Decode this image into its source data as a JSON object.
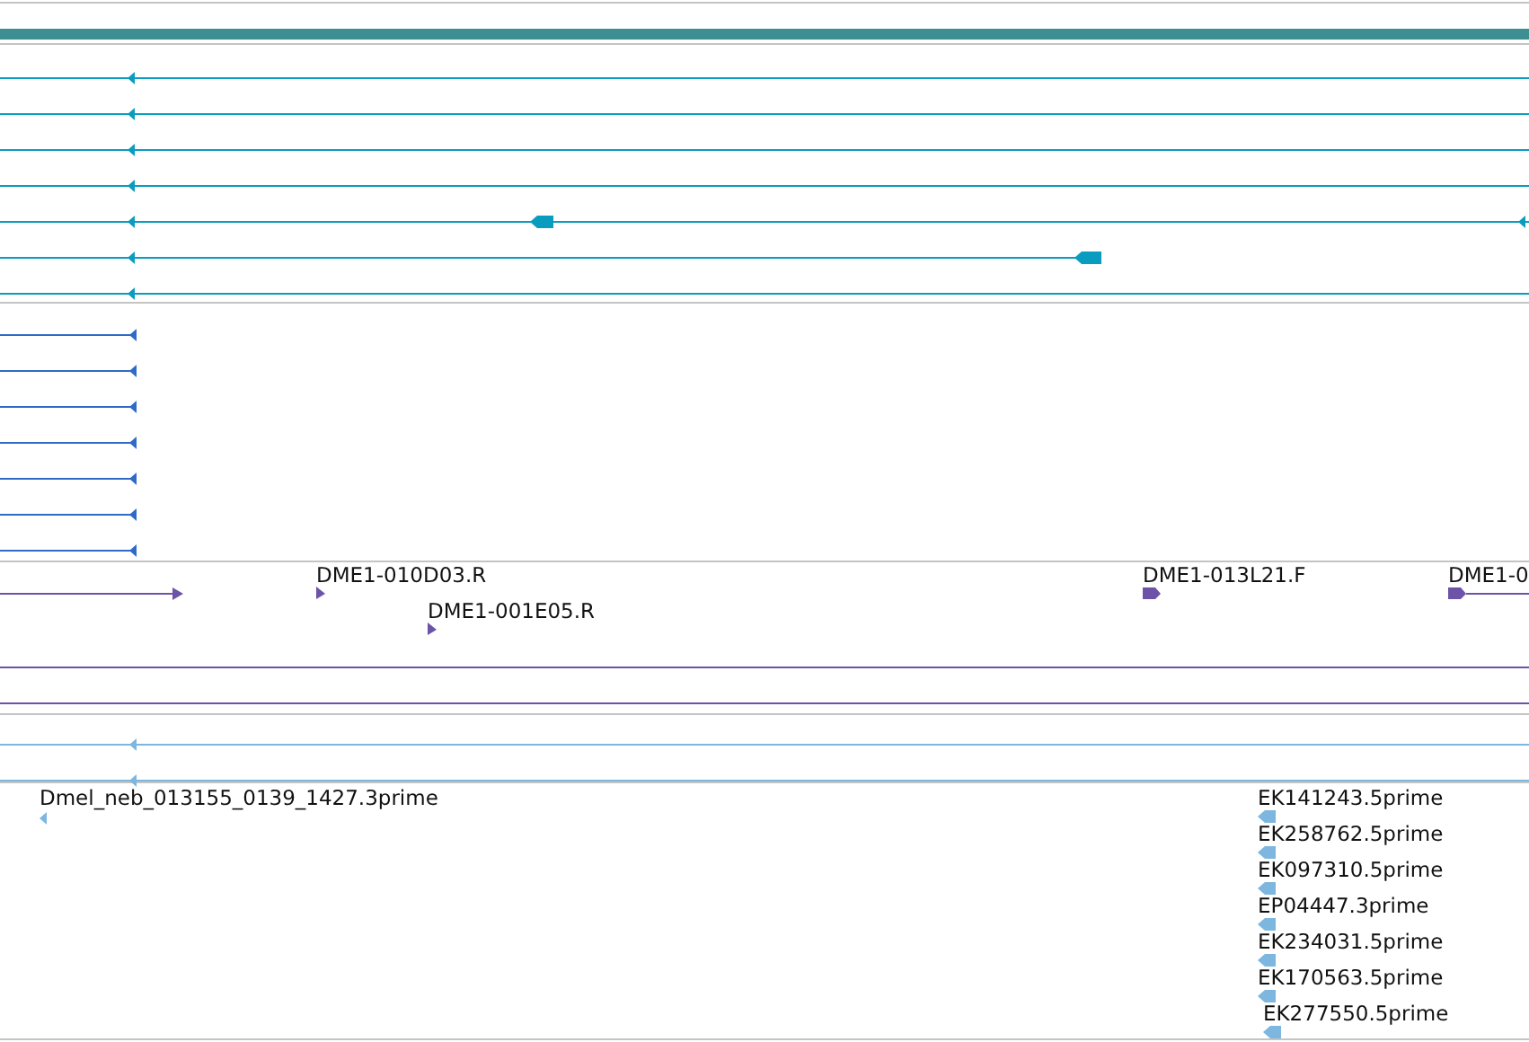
{
  "header_bar": {
    "color": "#3d8f93"
  },
  "tracks": [
    {
      "color": "#0a9cbf"
    },
    {
      "color": "#2f6bc6"
    },
    {
      "color": "#6d53a7",
      "labels": [
        "DME1-010D03.R",
        "DME1-001E05.R",
        "DME1-013L21.F",
        "DME1-0"
      ]
    },
    {
      "color": "#7db6de",
      "labels": [
        "Dmel_neb_013155_0139_1427.3prime",
        "EK141243.5prime",
        "EK258762.5prime",
        "EK097310.5prime",
        "EP04447.3prime",
        "EK234031.5prime",
        "EK170563.5prime",
        "EK277550.5prime"
      ]
    }
  ]
}
